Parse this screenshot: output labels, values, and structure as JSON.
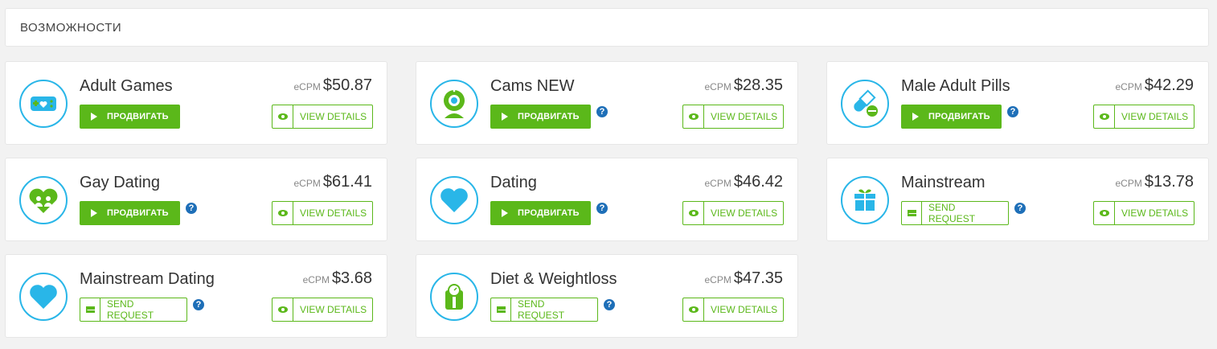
{
  "section_title": "ВОЗМОЖНОСТИ",
  "ecpm_label": "eCPM",
  "promote_label": "ПРОДВИГАТЬ",
  "request_label": "SEND REQUEST",
  "details_label": "VIEW DETAILS",
  "help_label": "?",
  "colors": {
    "accent_green": "#5bb81a",
    "icon_blue": "#29b6e8",
    "help_blue": "#1e6fb8"
  },
  "offers": [
    {
      "title": "Adult Games",
      "ecpm": "$50.87",
      "action": "promote",
      "has_help": false,
      "icon": "gamepad-heart-icon"
    },
    {
      "title": "Cams NEW",
      "ecpm": "$28.35",
      "action": "promote",
      "has_help": true,
      "icon": "webcam-icon"
    },
    {
      "title": "Male Adult Pills",
      "ecpm": "$42.29",
      "action": "promote",
      "has_help": true,
      "icon": "pills-icon"
    },
    {
      "title": "Gay Dating",
      "ecpm": "$61.41",
      "action": "promote",
      "has_help": true,
      "icon": "gay-heart-icon"
    },
    {
      "title": "Dating",
      "ecpm": "$46.42",
      "action": "promote",
      "has_help": true,
      "icon": "heart-icon"
    },
    {
      "title": "Mainstream",
      "ecpm": "$13.78",
      "action": "request",
      "has_help": true,
      "icon": "gift-icon"
    },
    {
      "title": "Mainstream Dating",
      "ecpm": "$3.68",
      "action": "request",
      "has_help": true,
      "icon": "heart-icon"
    },
    {
      "title": "Diet & Weightloss",
      "ecpm": "$47.35",
      "action": "request",
      "has_help": true,
      "icon": "scale-icon"
    }
  ]
}
